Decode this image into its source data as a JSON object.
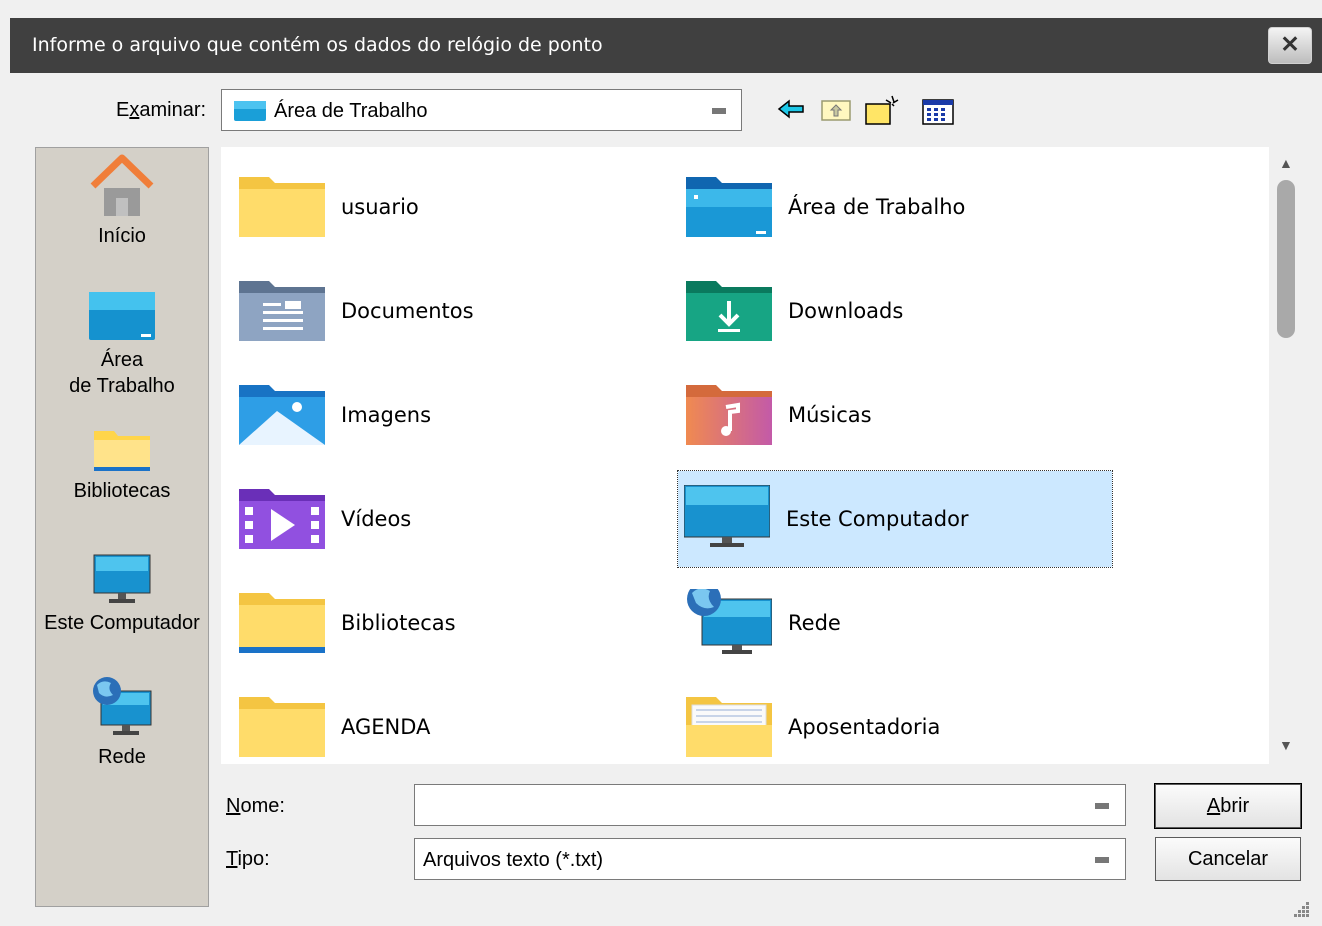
{
  "window": {
    "title": "Informe o arquivo que contém os dados do relógio de ponto",
    "close_label": "✕"
  },
  "lookin": {
    "label_pre": "E",
    "label_u": "x",
    "label_post": "aminar:",
    "value": "Área de Trabalho"
  },
  "toolbar": {
    "back": "back-icon",
    "up": "up-folder-icon",
    "new_folder": "new-folder-icon",
    "view": "view-menu-icon"
  },
  "places": [
    {
      "label_line1": "Início",
      "label_line2": "",
      "icon": "home-icon"
    },
    {
      "label_line1": "Área",
      "label_line2": "de Trabalho",
      "icon": "desktop-icon"
    },
    {
      "label_line1": "Bibliotecas",
      "label_line2": "",
      "icon": "libraries-icon"
    },
    {
      "label_line1": "Este Computador",
      "label_line2": "",
      "icon": "computer-icon"
    },
    {
      "label_line1": "Rede",
      "label_line2": "",
      "icon": "network-icon"
    }
  ],
  "files": [
    {
      "name": "usuario",
      "icon": "folder-icon"
    },
    {
      "name": "Área de Trabalho",
      "icon": "desktop-folder-icon"
    },
    {
      "name": "Documentos",
      "icon": "documents-folder-icon"
    },
    {
      "name": "Downloads",
      "icon": "downloads-folder-icon"
    },
    {
      "name": "Imagens",
      "icon": "pictures-folder-icon"
    },
    {
      "name": "Músicas",
      "icon": "music-folder-icon"
    },
    {
      "name": "Vídeos",
      "icon": "videos-folder-icon"
    },
    {
      "name": "Este Computador",
      "icon": "computer-icon",
      "selected": true
    },
    {
      "name": "Bibliotecas",
      "icon": "libraries-folder-icon"
    },
    {
      "name": "Rede",
      "icon": "network-icon"
    },
    {
      "name": "AGENDA",
      "icon": "folder-icon"
    },
    {
      "name": "Aposentadoria",
      "icon": "folder-with-files-icon"
    }
  ],
  "name_field": {
    "label_u": "N",
    "label_post": "ome:",
    "value": ""
  },
  "type_field": {
    "label_u": "T",
    "label_post": "ipo:",
    "value": "Arquivos texto (*.txt)"
  },
  "buttons": {
    "open_u": "A",
    "open_post": "brir",
    "cancel": "Cancelar"
  }
}
